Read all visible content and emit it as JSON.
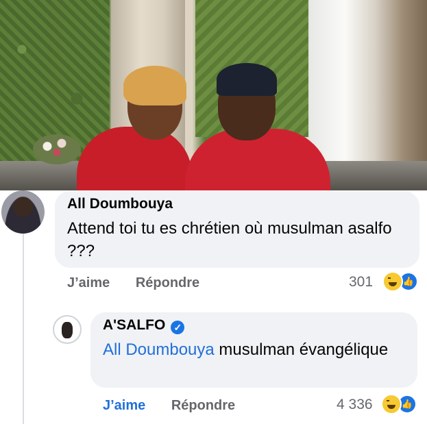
{
  "comments": [
    {
      "author": "All Doumbouya",
      "text": "Attend toi tu es chrétien où musulman asalfo ???",
      "like_label": "J’aime",
      "reply_label": "Répondre",
      "reaction_count": "301",
      "reactions": [
        "haha-icon",
        "like-icon"
      ]
    },
    {
      "author": "A'SALFO",
      "verified": true,
      "mention": "All Doumbouya",
      "text": " musulman évangélique",
      "like_label": "J’aime",
      "reply_label": "Répondre",
      "reaction_count": "4 336",
      "reactions": [
        "haha-icon",
        "like-icon"
      ],
      "liked_color": "#216fdb"
    }
  ],
  "colors": {
    "bubble": "#f0f2f5",
    "muted_text": "#65676b",
    "accent_blue": "#1b74e4"
  }
}
